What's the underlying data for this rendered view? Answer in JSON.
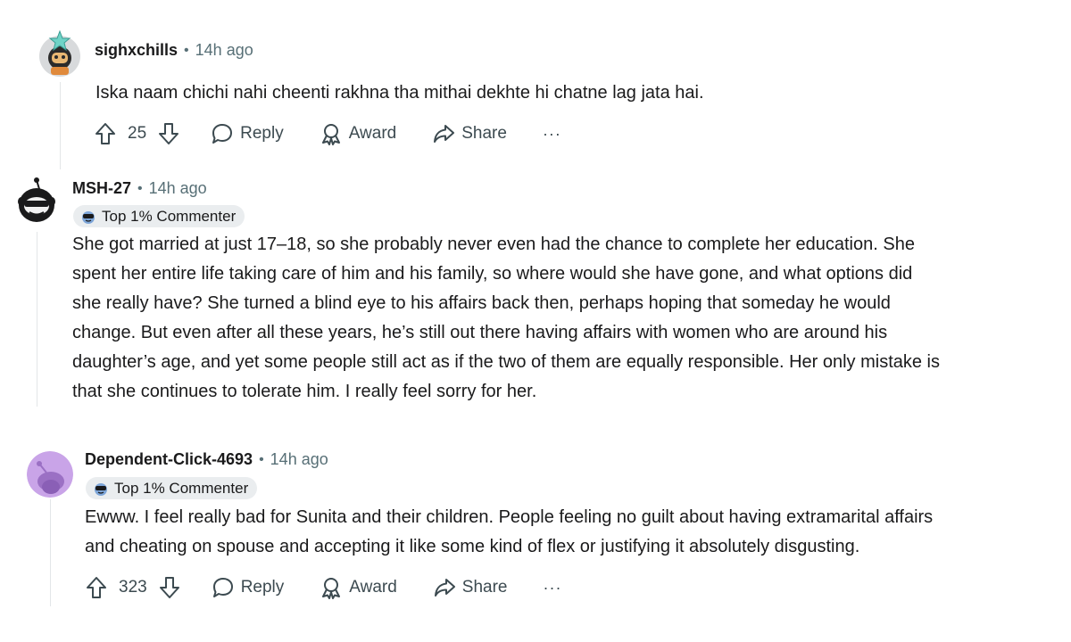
{
  "comments": [
    {
      "username": "sighxchills",
      "separator": "•",
      "time": "14h ago",
      "body": "Iska naam chichi nahi cheenti rakhna tha mithai dekhte hi chatne lag jata hai.",
      "votes": "25",
      "actions": {
        "reply": "Reply",
        "award": "Award",
        "share": "Share",
        "more": "···"
      }
    },
    {
      "username": "MSH-27",
      "separator": "•",
      "time": "14h ago",
      "flair": "Top 1% Commenter",
      "body_lines": [
        "She got married at just 17–18, so she probably never even had the chance to complete her education. She",
        "spent her entire life taking care of him and his family, so where would she have gone, and what options did",
        "she really have? She turned a blind eye to his affairs back then, perhaps hoping that someday he would",
        "change. But even after all these years, he’s still out there having affairs with women who are around his",
        "daughter’s age, and yet some people still act as if the two of them are equally responsible. Her only mistake is",
        "that she continues to tolerate him. I really feel sorry for her."
      ]
    },
    {
      "username": "Dependent-Click-4693",
      "separator": "•",
      "time": "14h ago",
      "flair": "Top 1% Commenter",
      "body_lines": [
        "Ewww. I feel really bad for Sunita and their children. People feeling no guilt about having extramarital affairs",
        "and cheating on spouse and accepting it like some kind of flex or justifying it absolutely disgusting."
      ],
      "votes": "323",
      "actions": {
        "reply": "Reply",
        "award": "Award",
        "share": "Share",
        "more": "···"
      }
    }
  ],
  "icons": {
    "upvote": "arrow-up-icon",
    "downvote": "arrow-down-icon",
    "reply": "speech-bubble-icon",
    "award": "award-ribbon-icon",
    "share": "share-arrow-icon",
    "more": "more-dots-icon",
    "flair": "sunglasses-icon"
  },
  "colors": {
    "text": "#1a1a1b",
    "meta": "#576f76",
    "flair_bg": "#eaedef",
    "thread_line": "#e3e6e8",
    "avatar_purple": "#c9a4e8"
  }
}
